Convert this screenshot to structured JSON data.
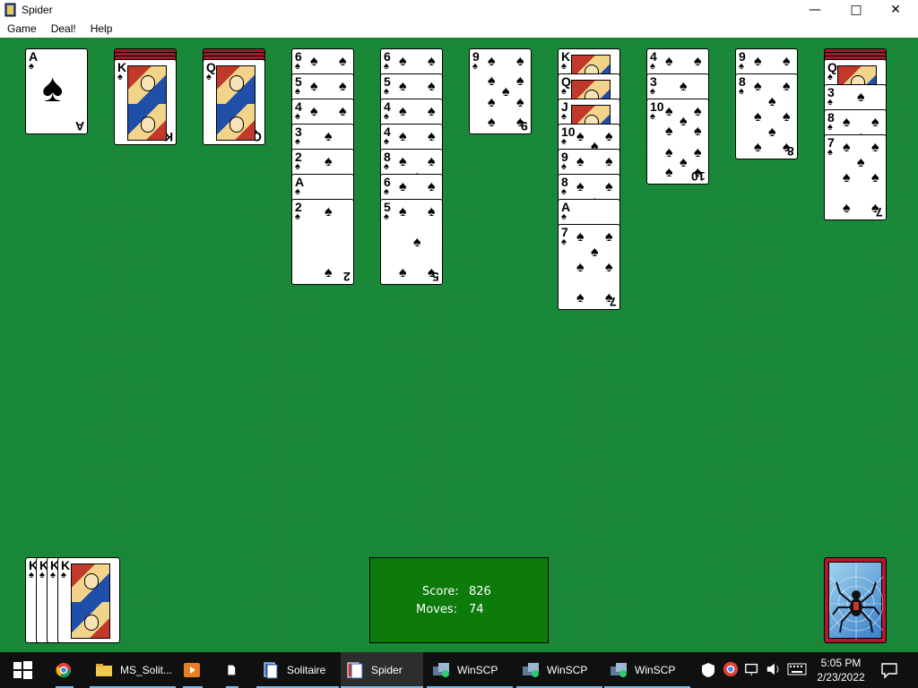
{
  "window": {
    "title": "Spider",
    "min": "—",
    "max": "□",
    "close": "✕"
  },
  "menu": [
    "Game",
    "Deal!",
    "Help"
  ],
  "colors": {
    "felt": "#1a8a3a",
    "card_back": "#a31b2a",
    "score_box": "#0c7b0c",
    "taskbar": "#101010"
  },
  "foundations_completed": 4,
  "score": {
    "score_label": "Score:",
    "score_value": "826",
    "moves_label": "Moves:",
    "moves_value": "74"
  },
  "tableau": [
    {
      "facedown": 0,
      "cards": [
        {
          "rank": "A",
          "suit": "♠"
        }
      ]
    },
    {
      "facedown": 3,
      "cards": [
        {
          "rank": "K",
          "suit": "♠"
        }
      ]
    },
    {
      "facedown": 3,
      "cards": [
        {
          "rank": "Q",
          "suit": "♠"
        }
      ]
    },
    {
      "facedown": 0,
      "cards": [
        {
          "rank": "6",
          "suit": "♠"
        },
        {
          "rank": "5",
          "suit": "♠"
        },
        {
          "rank": "4",
          "suit": "♠"
        },
        {
          "rank": "3",
          "suit": "♠"
        },
        {
          "rank": "2",
          "suit": "♠"
        },
        {
          "rank": "A",
          "suit": "♠"
        },
        {
          "rank": "2",
          "suit": "♠"
        }
      ]
    },
    {
      "facedown": 0,
      "cards": [
        {
          "rank": "6",
          "suit": "♠"
        },
        {
          "rank": "5",
          "suit": "♠"
        },
        {
          "rank": "4",
          "suit": "♠"
        },
        {
          "rank": "4",
          "suit": "♠"
        },
        {
          "rank": "8",
          "suit": "♠"
        },
        {
          "rank": "6",
          "suit": "♠"
        },
        {
          "rank": "5",
          "suit": "♠"
        }
      ]
    },
    {
      "facedown": 0,
      "cards": [
        {
          "rank": "9",
          "suit": "♠"
        }
      ]
    },
    {
      "facedown": 0,
      "cards": [
        {
          "rank": "K",
          "suit": "♠"
        },
        {
          "rank": "Q",
          "suit": "♠"
        },
        {
          "rank": "J",
          "suit": "♠"
        },
        {
          "rank": "10",
          "suit": "♠"
        },
        {
          "rank": "9",
          "suit": "♠"
        },
        {
          "rank": "8",
          "suit": "♠"
        },
        {
          "rank": "A",
          "suit": "♠"
        },
        {
          "rank": "7",
          "suit": "♠"
        }
      ]
    },
    {
      "facedown": 0,
      "cards": [
        {
          "rank": "4",
          "suit": "♠"
        },
        {
          "rank": "3",
          "suit": "♠"
        },
        {
          "rank": "10",
          "suit": "♠"
        }
      ]
    },
    {
      "facedown": 0,
      "cards": [
        {
          "rank": "9",
          "suit": "♠"
        },
        {
          "rank": "8",
          "suit": "♠"
        }
      ]
    },
    {
      "facedown": 3,
      "cards": [
        {
          "rank": "Q",
          "suit": "♠"
        },
        {
          "rank": "3",
          "suit": "♠"
        },
        {
          "rank": "8",
          "suit": "♠"
        },
        {
          "rank": "7",
          "suit": "♠"
        }
      ]
    }
  ],
  "completed_stack": [
    {
      "rank": "K",
      "suit": "♠"
    },
    {
      "rank": "K",
      "suit": "♠"
    },
    {
      "rank": "K",
      "suit": "♠"
    },
    {
      "rank": "K",
      "suit": "♠"
    }
  ],
  "taskbar": {
    "items": [
      {
        "label": "",
        "icon": "chrome-icon"
      },
      {
        "label": "MS_Solit...",
        "icon": "folder-icon"
      },
      {
        "label": "",
        "icon": "media-player-icon"
      },
      {
        "label": "",
        "icon": "document-icon"
      },
      {
        "label": "Solitaire",
        "icon": "solitaire-icon"
      },
      {
        "label": "Spider",
        "icon": "spider-icon",
        "active": true
      },
      {
        "label": "WinSCP",
        "icon": "winscp-icon"
      },
      {
        "label": "WinSCP",
        "icon": "winscp-icon"
      },
      {
        "label": "WinSCP",
        "icon": "winscp-icon"
      }
    ],
    "clock_time": "5:05 PM",
    "clock_date": "2/23/2022"
  }
}
